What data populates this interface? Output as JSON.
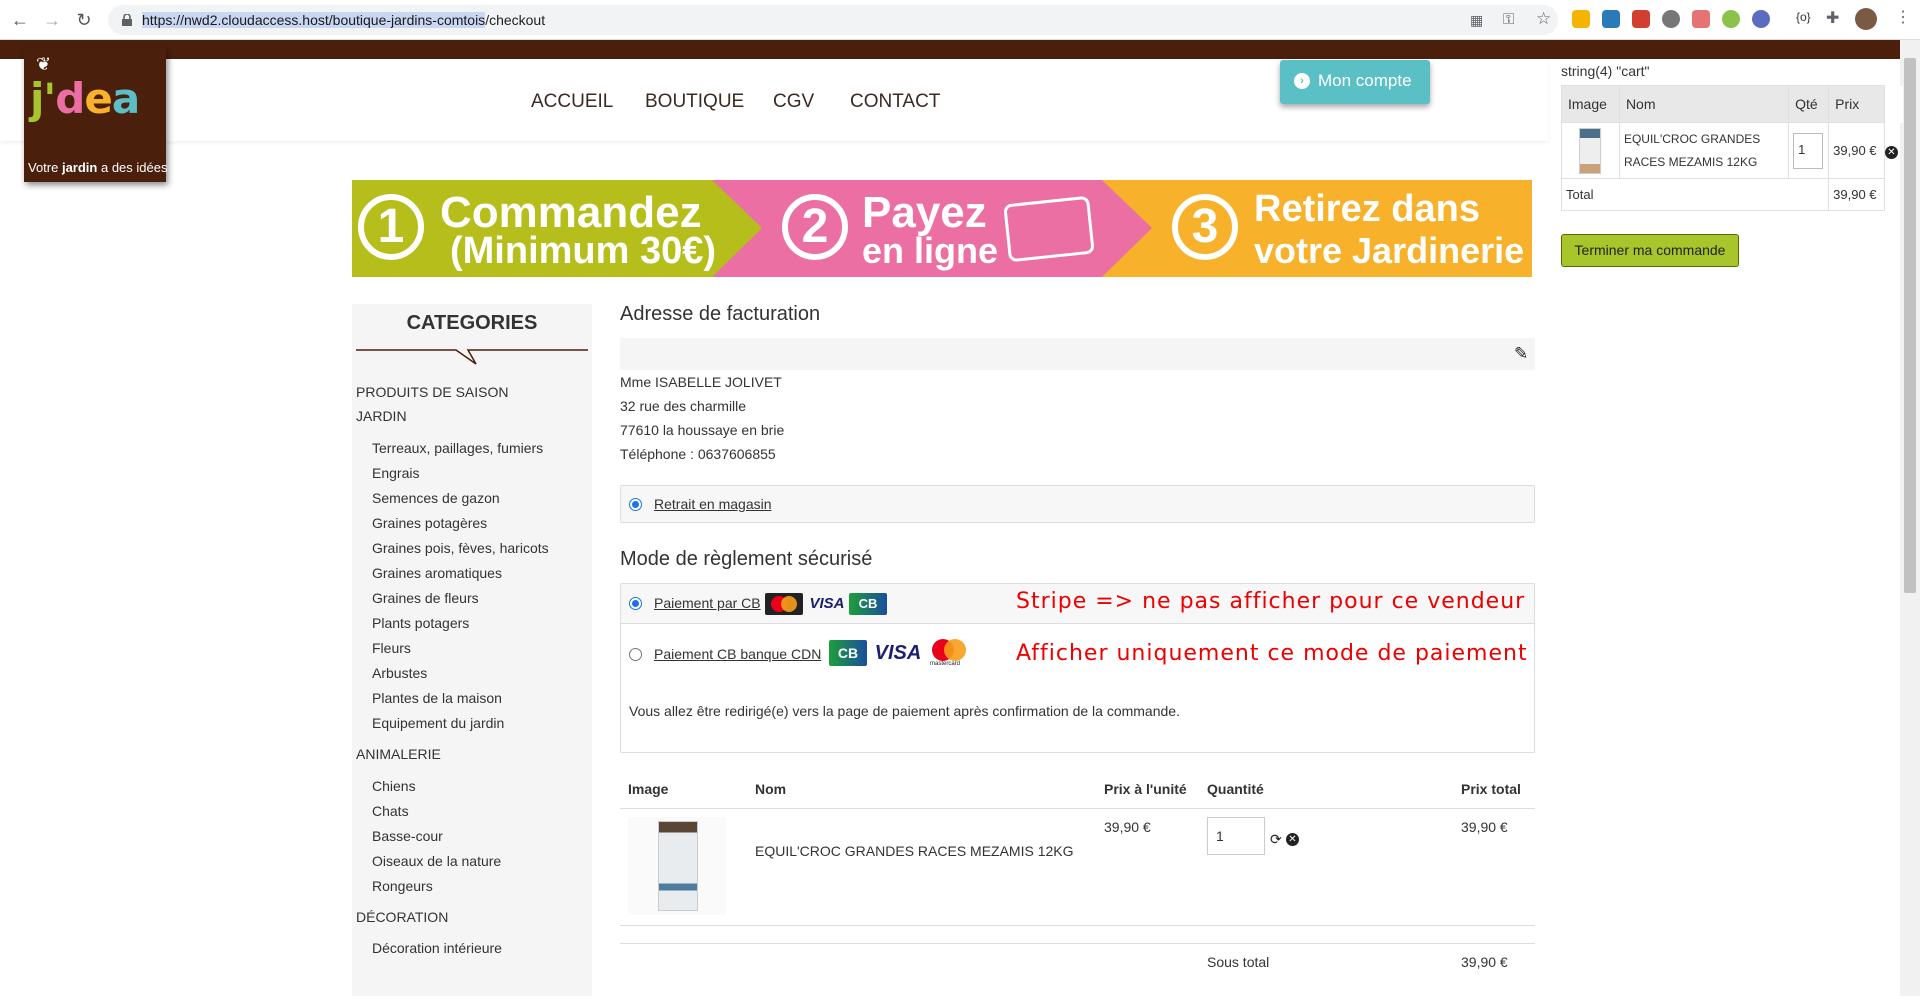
{
  "browser": {
    "url_host": "https://nwd2.cloudaccess.host/boutique-jardins-comtois",
    "url_path": "/checkout",
    "back_icon": "←",
    "forward_icon": "→",
    "reload_icon": "↻"
  },
  "logo": {
    "word": "j'dea",
    "slogan_pre": "Votre ",
    "slogan_bold": "jardin",
    "slogan_post": " a des idées"
  },
  "menu": [
    "ACCUEIL",
    "BOUTIQUE",
    "CGV",
    "CONTACT"
  ],
  "account_button": "Mon compte",
  "cart": {
    "debug": "string(4) \"cart\"",
    "headers": [
      "Image",
      "Nom",
      "Qté",
      "Prix"
    ],
    "item_name": "EQUIL'CROC GRANDES RACES MEZAMIS 12KG",
    "item_qty": "1",
    "item_price": "39,90 €",
    "total_label": "Total",
    "total_value": "39,90 €",
    "finish_button": "Terminer ma commande"
  },
  "banner": {
    "step1_num": "1",
    "step1_l1": "Commandez",
    "step1_l2": "(Minimum 30€)",
    "step2_num": "2",
    "step2_l1": "Payez",
    "step2_l2": "en ligne",
    "step3_num": "3",
    "step3_l1": "Retirez dans",
    "step3_l2": "votre Jardinerie",
    "colors": {
      "step1": "#b5be1a",
      "step2": "#ec6fa4",
      "step3": "#f7b12a"
    }
  },
  "sidebar": {
    "title": "CATEGORIES",
    "cat_saison": "PRODUITS DE SAISON",
    "cat_jardin": "JARDIN",
    "jardin_items": [
      "Terreaux, paillages, fumiers",
      "Engrais",
      "Semences de gazon",
      "Graines potagères",
      "Graines pois, fèves, haricots",
      "Graines aromatiques",
      "Graines de fleurs",
      "Plants potagers",
      "Fleurs",
      "Arbustes",
      "Plantes de la maison",
      "Equipement du jardin"
    ],
    "cat_animalerie": "ANIMALERIE",
    "animalerie_items": [
      "Chiens",
      "Chats",
      "Basse-cour",
      "Oiseaux de la nature",
      "Rongeurs"
    ],
    "cat_decoration": "DÉCORATION",
    "decoration_items": [
      "Décoration intérieure"
    ]
  },
  "billing": {
    "title": "Adresse de facturation",
    "name": "Mme ISABELLE JOLIVET",
    "street": "32 rue des charmille",
    "city": "77610 la houssaye en brie",
    "phone": "Téléphone : 0637606855",
    "shipping_option": "Retrait en magasin"
  },
  "payment": {
    "title": "Mode de règlement sécurisé",
    "option1": "Paiement par CB",
    "option2": "Paiement CB banque CDN",
    "note1": "Stripe => ne pas afficher pour ce vendeur",
    "note2": "Afficher uniquement ce mode de paiement",
    "redirect_text": "Vous allez être redirigé(e) vers la page de paiement après confirmation de la commande.",
    "visa": "VISA",
    "cb": "CB",
    "mastercard_label": "mastercard"
  },
  "product_table": {
    "headers": [
      "Image",
      "Nom",
      "Prix à l'unité",
      "Quantité",
      "Prix total"
    ],
    "name": "EQUIL'CROC GRANDES RACES MEZAMIS 12KG",
    "unit_price": "39,90 €",
    "qty": "1",
    "total": "39,90 €",
    "subtotal_label": "Sous total",
    "subtotal_value": "39,90 €"
  }
}
